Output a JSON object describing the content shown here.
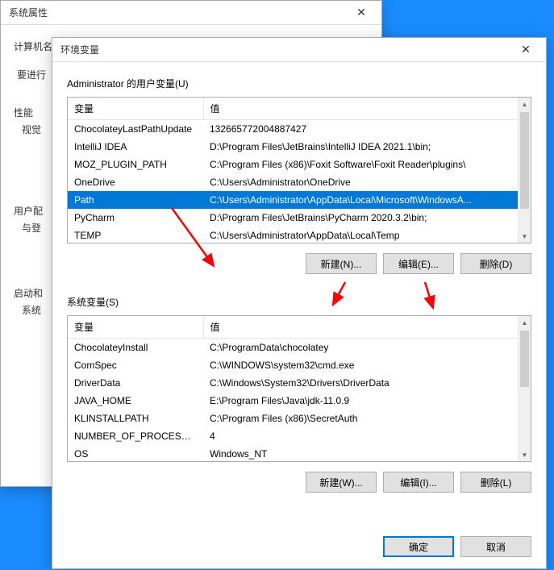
{
  "sys_dialog": {
    "title": "系统属性",
    "tabs_text": "计算机名",
    "body_text": "要进行",
    "labels": [
      "性能",
      "视觉",
      "用户配",
      "与登",
      "启动和",
      "系统"
    ]
  },
  "env_dialog": {
    "title": "环境变量",
    "user_section_label": "Administrator 的用户变量(U)",
    "sys_section_label": "系统变量(S)",
    "headers": {
      "var": "变量",
      "val": "值"
    },
    "user_vars": [
      {
        "name": "ChocolateyLastPathUpdate",
        "value": "132665772004887427"
      },
      {
        "name": "IntelliJ IDEA",
        "value": "D:\\Program Files\\JetBrains\\IntelliJ IDEA 2021.1\\bin;"
      },
      {
        "name": "MOZ_PLUGIN_PATH",
        "value": "C:\\Program Files (x86)\\Foxit Software\\Foxit Reader\\plugins\\"
      },
      {
        "name": "OneDrive",
        "value": "C:\\Users\\Administrator\\OneDrive"
      },
      {
        "name": "Path",
        "value": "C:\\Users\\Administrator\\AppData\\Local\\Microsoft\\WindowsA..."
      },
      {
        "name": "PyCharm",
        "value": "D:\\Program Files\\JetBrains\\PyCharm 2020.3.2\\bin;"
      },
      {
        "name": "TEMP",
        "value": "C:\\Users\\Administrator\\AppData\\Local\\Temp"
      }
    ],
    "user_selected": 4,
    "sys_vars": [
      {
        "name": "ChocolateyInstall",
        "value": "C:\\ProgramData\\chocolatey"
      },
      {
        "name": "ComSpec",
        "value": "C:\\WINDOWS\\system32\\cmd.exe"
      },
      {
        "name": "DriverData",
        "value": "C:\\Windows\\System32\\Drivers\\DriverData"
      },
      {
        "name": "JAVA_HOME",
        "value": "E:\\Program Files\\Java\\jdk-11.0.9"
      },
      {
        "name": "KLINSTALLPATH",
        "value": "C:\\Program Files (x86)\\SecretAuth"
      },
      {
        "name": "NUMBER_OF_PROCESSORS",
        "value": "4"
      },
      {
        "name": "OS",
        "value": "Windows_NT"
      }
    ],
    "buttons": {
      "user_new": "新建(N)...",
      "user_edit": "编辑(E)...",
      "user_delete": "删除(D)",
      "sys_new": "新建(W)...",
      "sys_edit": "编辑(I)...",
      "sys_delete": "删除(L)",
      "ok": "确定",
      "cancel": "取消"
    }
  }
}
